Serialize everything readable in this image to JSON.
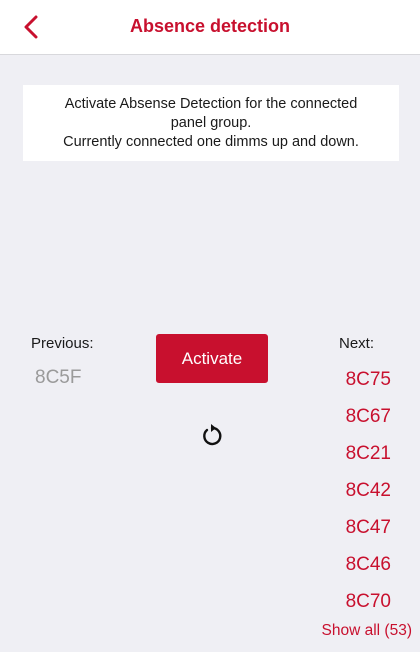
{
  "header": {
    "title": "Absence detection",
    "back_icon": "chevron-left-icon"
  },
  "info": {
    "lines": [
      "Activate Absense Detection for the connected",
      "panel group.",
      "Currently connected one dimms up and down."
    ]
  },
  "previous": {
    "label": "Previous:",
    "value": "8C5F"
  },
  "action": {
    "activate_label": "Activate",
    "refresh_icon": "refresh-icon"
  },
  "next": {
    "label": "Next:",
    "items": [
      "8C75",
      "8C67",
      "8C21",
      "8C42",
      "8C47",
      "8C46",
      "8C70"
    ],
    "show_all_label": "Show all (53)"
  },
  "colors": {
    "accent": "#c8102e",
    "background": "#efeff4",
    "muted": "#9a9a9a"
  }
}
